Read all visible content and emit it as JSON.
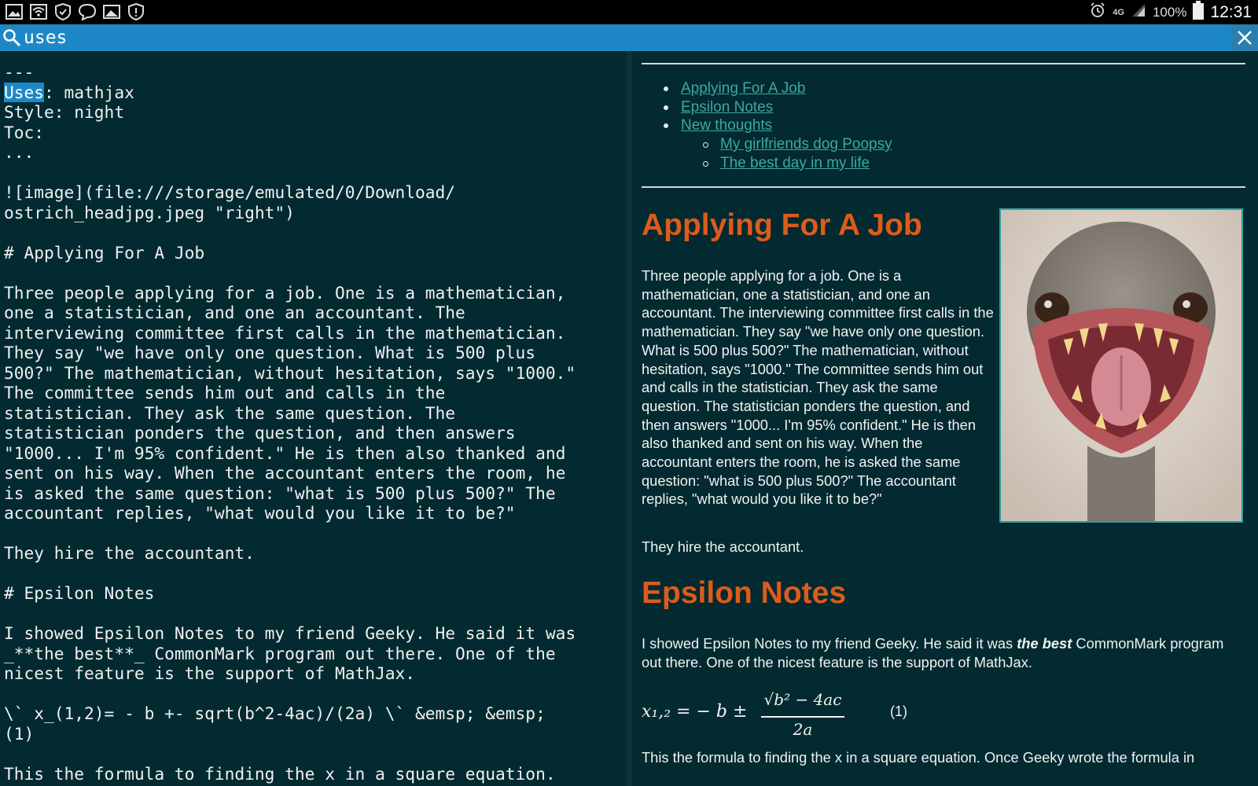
{
  "statusbar": {
    "left_icons": [
      "gallery-icon",
      "wifi-icon",
      "shield-check-icon",
      "chat-bubble-icon",
      "image-icon",
      "alert-shield-icon"
    ],
    "network_type": "4G",
    "battery": "100%",
    "time": "12:31"
  },
  "search": {
    "value": "uses"
  },
  "editor": {
    "highlight": "Uses",
    "lines_before": "---\n",
    "line_after_highlight": ": mathjax\nStyle: night\nToc:\n...\n\n![image](file:///storage/emulated/0/Download/\nostrich_headjpg.jpeg \"right\")\n\n# Applying For A Job\n\nThree people applying for a job. One is a mathematician,\none a statistician, and one an accountant. The\ninterviewing committee first calls in the mathematician.\nThey say \"we have only one question. What is 500 plus\n500?\" The mathematician, without hesitation, says \"1000.\"\nThe committee sends him out and calls in the\nstatistician. They ask the same question. The\nstatistician ponders the question, and then answers\n\"1000... I'm 95% confident.\" He is then also thanked and\nsent on his way. When the accountant enters the room, he\nis asked the same question: \"what is 500 plus 500?\" The\naccountant replies, \"what would you like it to be?\"\n\nThey hire the accountant.\n\n# Epsilon Notes\n\nI showed Epsilon Notes to my friend Geeky. He said it was\n_**the best**_ CommonMark program out there. One of the\nnicest feature is the support of MathJax.\n\n\\` x_(1,2)= - b +- sqrt(b^2-4ac)/(2a) \\` &emsp; &emsp;\n(1)\n\nThis the formula to finding the x in a square equation."
  },
  "preview": {
    "toc": [
      {
        "label": "Applying For A Job"
      },
      {
        "label": "Epsilon Notes"
      },
      {
        "label": "New thoughts",
        "children": [
          {
            "label": "My girlfriends dog Poopsy"
          },
          {
            "label": "The best day in my life"
          }
        ]
      }
    ],
    "section1": {
      "heading": "Applying For A Job",
      "paragraph": "Three people applying for a job. One is a mathematician, one a statistician, and one an accountant. The interviewing committee first calls in the mathematician. They say \"we have only one question. What is 500 plus 500?\" The mathematician, without hesitation, says \"1000.\" The committee sends him out and calls in the statistician. They ask the same question. The statistician ponders the question, and then answers \"1000... I'm 95% confident.\" He is then also thanked and sent on his way. When the accountant enters the room, he is asked the same question: \"what is 500 plus 500?\" The accountant replies, \"what would you like it to be?\"",
      "conclusion": "They hire the accountant."
    },
    "section2": {
      "heading": "Epsilon Notes",
      "p_before": "I showed Epsilon Notes to my friend Geeky. He said it was ",
      "p_emph": "the best",
      "p_after": " CommonMark program out there. One of the nicest feature is the support of MathJax.",
      "formula_lhs": "x₁,₂ = − b ±",
      "formula_num": "√b² − 4ac",
      "formula_den": "2a",
      "formula_tag": "(1)",
      "last_line": "This the formula to finding the x in a square equation. Once Geeky wrote the formula in"
    }
  }
}
